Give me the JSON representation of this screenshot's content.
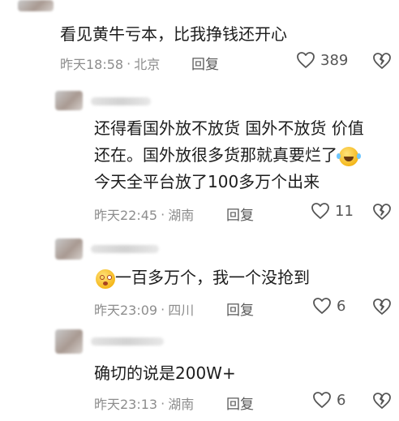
{
  "comments": [
    {
      "text_lines": [
        "看见黄牛亏本，比我挣钱还开心"
      ],
      "time": "昨天18:58",
      "location": "北京",
      "reply_label": "回复",
      "likes": "389"
    },
    {
      "text_lines": [
        "还得看国外放不放货 国外不放货 价值",
        "还在。国外放很多货那就真要烂了",
        "今天全平台放了100多万个出来"
      ],
      "time": "昨天22:45",
      "location": "湖南",
      "reply_label": "回复",
      "likes": "11"
    },
    {
      "text_lines": [
        "一百多万个，我一个没抢到"
      ],
      "time": "昨天23:09",
      "location": "四川",
      "reply_label": "回复",
      "likes": "6"
    },
    {
      "text_lines": [
        "确切的说是200W+"
      ],
      "time": "昨天23:13",
      "location": "湖南",
      "reply_label": "回复",
      "likes": "6"
    }
  ],
  "separator": "·",
  "icons": {
    "like": "heart-outline-icon",
    "dislike": "broken-heart-icon",
    "emoji_laugh": "laughing-tears-emoji",
    "emoji_dizzy": "dizzy-face-emoji"
  },
  "colors": {
    "meta": "#8d8d8d",
    "text": "#1c1c1c",
    "icon": "#555555"
  }
}
